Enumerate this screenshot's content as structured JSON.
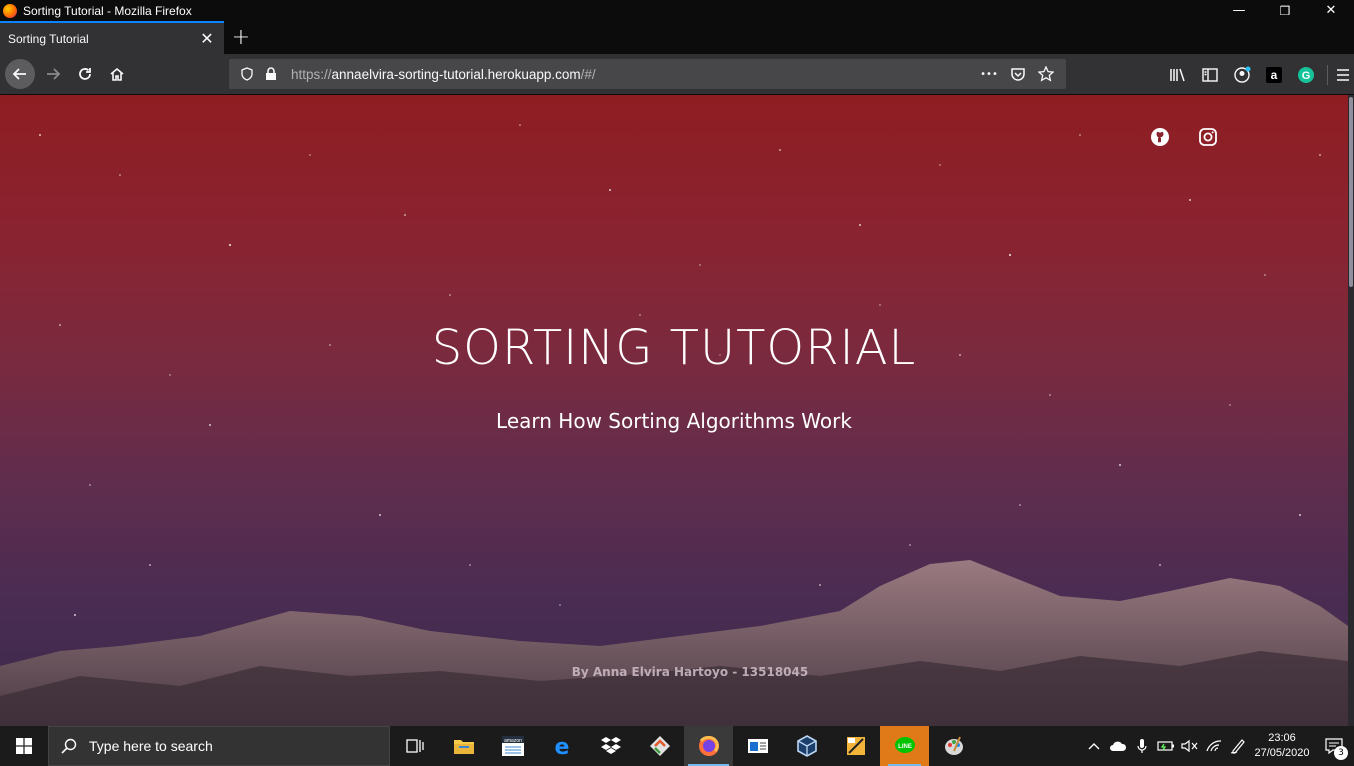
{
  "window": {
    "title": "Sorting Tutorial - Mozilla Firefox",
    "controls": {
      "minimize": "—",
      "maximize": "❒",
      "close": "✕"
    }
  },
  "tabs": [
    {
      "label": "Sorting Tutorial",
      "close": "✕"
    }
  ],
  "new_tab": "+",
  "navbar": {
    "url_prefix": "https://",
    "url_host": "annaelvira-sorting-tutorial.herokuapp.com",
    "url_path": "/#/",
    "more": "•••"
  },
  "page": {
    "title": "SORTING TUTORIAL",
    "subtitle": "Learn How Sorting Algorithms Work",
    "byline": "By Anna Elvira Hartoyo - 13518045"
  },
  "taskbar": {
    "search_placeholder": "Type here to search",
    "clock_time": "23:06",
    "clock_date": "27/05/2020",
    "notification_count": "3"
  },
  "colors": {
    "accent": "#0a84ff",
    "page_top": "#8e1d22",
    "page_bottom": "#3a2a4a"
  }
}
